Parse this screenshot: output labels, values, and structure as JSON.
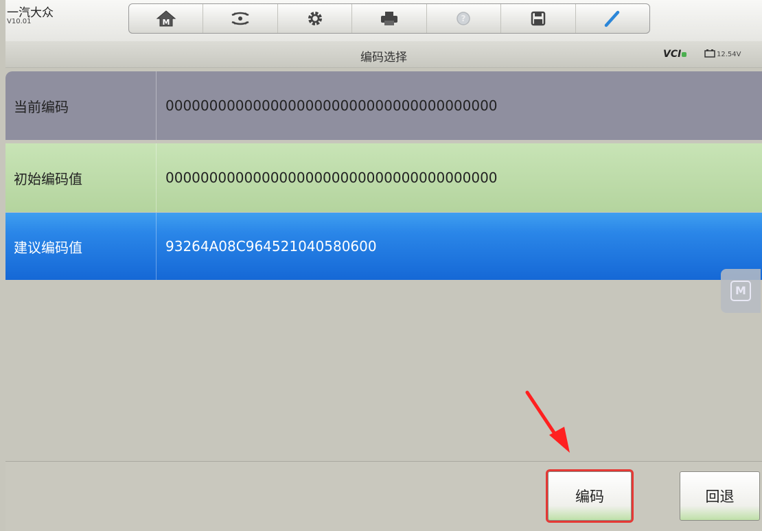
{
  "header": {
    "brand": "一汽大众",
    "version": "V10.01",
    "toolbar": [
      {
        "icon": "home-icon"
      },
      {
        "icon": "vehicle-swap-icon"
      },
      {
        "icon": "gear-icon"
      },
      {
        "icon": "printer-icon"
      },
      {
        "icon": "help-icon"
      },
      {
        "icon": "save-icon"
      },
      {
        "icon": "pen-icon"
      }
    ]
  },
  "titlebar": {
    "title": "编码选择",
    "vci_label": "VCI",
    "voltage": "12.54V"
  },
  "rows": [
    {
      "label": "当前编码",
      "value": "00000000000000000000000000000000000000"
    },
    {
      "label": "初始编码值",
      "value": "00000000000000000000000000000000000000"
    },
    {
      "label": "建议编码值",
      "value": "93264A08C964521040580600"
    }
  ],
  "buttons": {
    "code": "编码",
    "back": "回退"
  },
  "colors": {
    "current_row": "#8f8f9f",
    "initial_row": "#bcdba6",
    "suggested_row": "#1e77e0",
    "highlight": "#e53935",
    "background": "#c7c6bc"
  }
}
